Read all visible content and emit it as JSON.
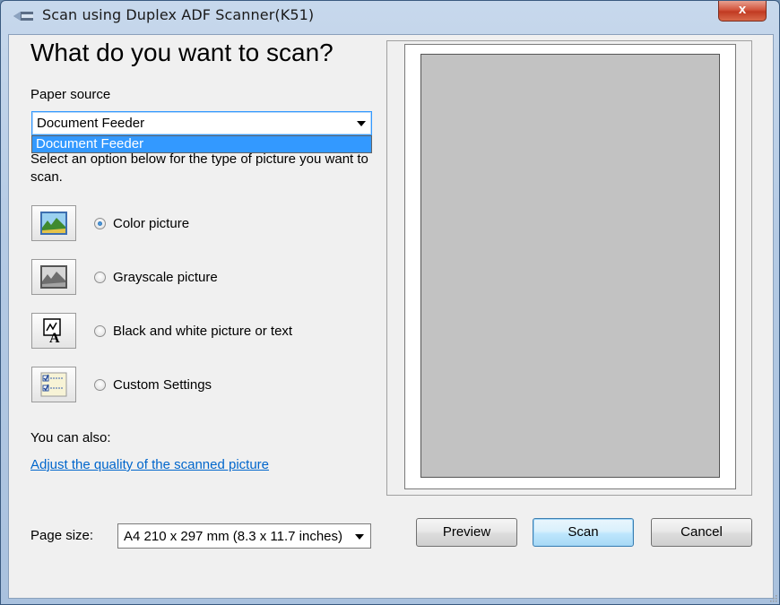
{
  "window": {
    "title": "Scan using Duplex ADF Scanner(K51)",
    "close_label": "x"
  },
  "main": {
    "heading": "What do you want to scan?",
    "paper_source_label": "Paper source",
    "paper_source_value": "Document Feeder",
    "paper_source_options": [
      "Document Feeder"
    ],
    "type_description": "Select an option below for the type of picture you want to scan.",
    "scan_types": [
      {
        "label": "Color picture",
        "icon": "color-picture-icon",
        "selected": true
      },
      {
        "label": "Grayscale picture",
        "icon": "grayscale-picture-icon",
        "selected": false
      },
      {
        "label": "Black and white picture or text",
        "icon": "bw-picture-text-icon",
        "selected": false
      },
      {
        "label": "Custom Settings",
        "icon": "custom-settings-icon",
        "selected": false
      }
    ],
    "also_label": "You can also:",
    "adjust_link": "Adjust the quality of the scanned picture",
    "page_size_label": "Page size:",
    "page_size_value": "A4 210 x 297 mm (8.3 x 11.7 inches)"
  },
  "buttons": {
    "preview": "Preview",
    "scan": "Scan",
    "cancel": "Cancel"
  }
}
